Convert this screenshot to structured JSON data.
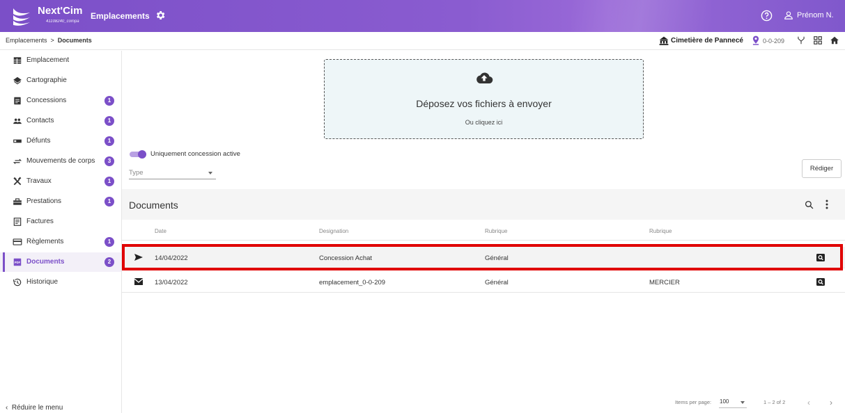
{
  "topbar": {
    "brand": "Next'Cim",
    "brand_sub": "41108240_compa",
    "module": "Emplacements",
    "user": "Prénom N.",
    "color": "#7b4fc8"
  },
  "breadcrumb": {
    "parent": "Emplacements",
    "separator": ">",
    "current": "Documents"
  },
  "location": {
    "cemetery": "Cimetière de Pannecé",
    "code": "0-0-209"
  },
  "sidebar": {
    "items": [
      {
        "label": "Emplacement",
        "icon": "table-icon",
        "badge": null
      },
      {
        "label": "Cartographie",
        "icon": "layers-icon",
        "badge": null
      },
      {
        "label": "Concessions",
        "icon": "document-icon",
        "badge": "1"
      },
      {
        "label": "Contacts",
        "icon": "people-icon",
        "badge": "1"
      },
      {
        "label": "Défunts",
        "icon": "bed-icon",
        "badge": "1"
      },
      {
        "label": "Mouvements de corps",
        "icon": "swap-icon",
        "badge": "3"
      },
      {
        "label": "Travaux",
        "icon": "tools-icon",
        "badge": "1"
      },
      {
        "label": "Prestations",
        "icon": "toolbox-icon",
        "badge": "1"
      },
      {
        "label": "Factures",
        "icon": "receipt-icon",
        "badge": null
      },
      {
        "label": "Règlements",
        "icon": "card-icon",
        "badge": "1"
      },
      {
        "label": "Documents",
        "icon": "pdf-icon",
        "badge": "2",
        "active": true
      },
      {
        "label": "Historique",
        "icon": "history-icon",
        "badge": null
      }
    ],
    "reduce": "Réduire le menu"
  },
  "dropzone": {
    "title": "Déposez vos fichiers à envoyer",
    "subtitle": "Ou cliquez ici"
  },
  "filters": {
    "toggle_label": "Uniquement concession active",
    "toggle_on": true,
    "type_placeholder": "Type",
    "rediger": "Rédiger"
  },
  "documents": {
    "title": "Documents",
    "columns": [
      "Date",
      "Designation",
      "Rubrique",
      "Rubrique"
    ],
    "rows": [
      {
        "icon": "send-icon",
        "date": "14/04/2022",
        "designation": "Concession Achat",
        "rubrique": "Général",
        "rubrique2": ""
      },
      {
        "icon": "mail-icon",
        "date": "13/04/2022",
        "designation": "emplacement_0-0-209",
        "rubrique": "Général",
        "rubrique2": "MERCIER"
      }
    ]
  },
  "pagination": {
    "items_per_page_label": "Items per page:",
    "page_size": "100",
    "range": "1 – 2 of 2"
  }
}
